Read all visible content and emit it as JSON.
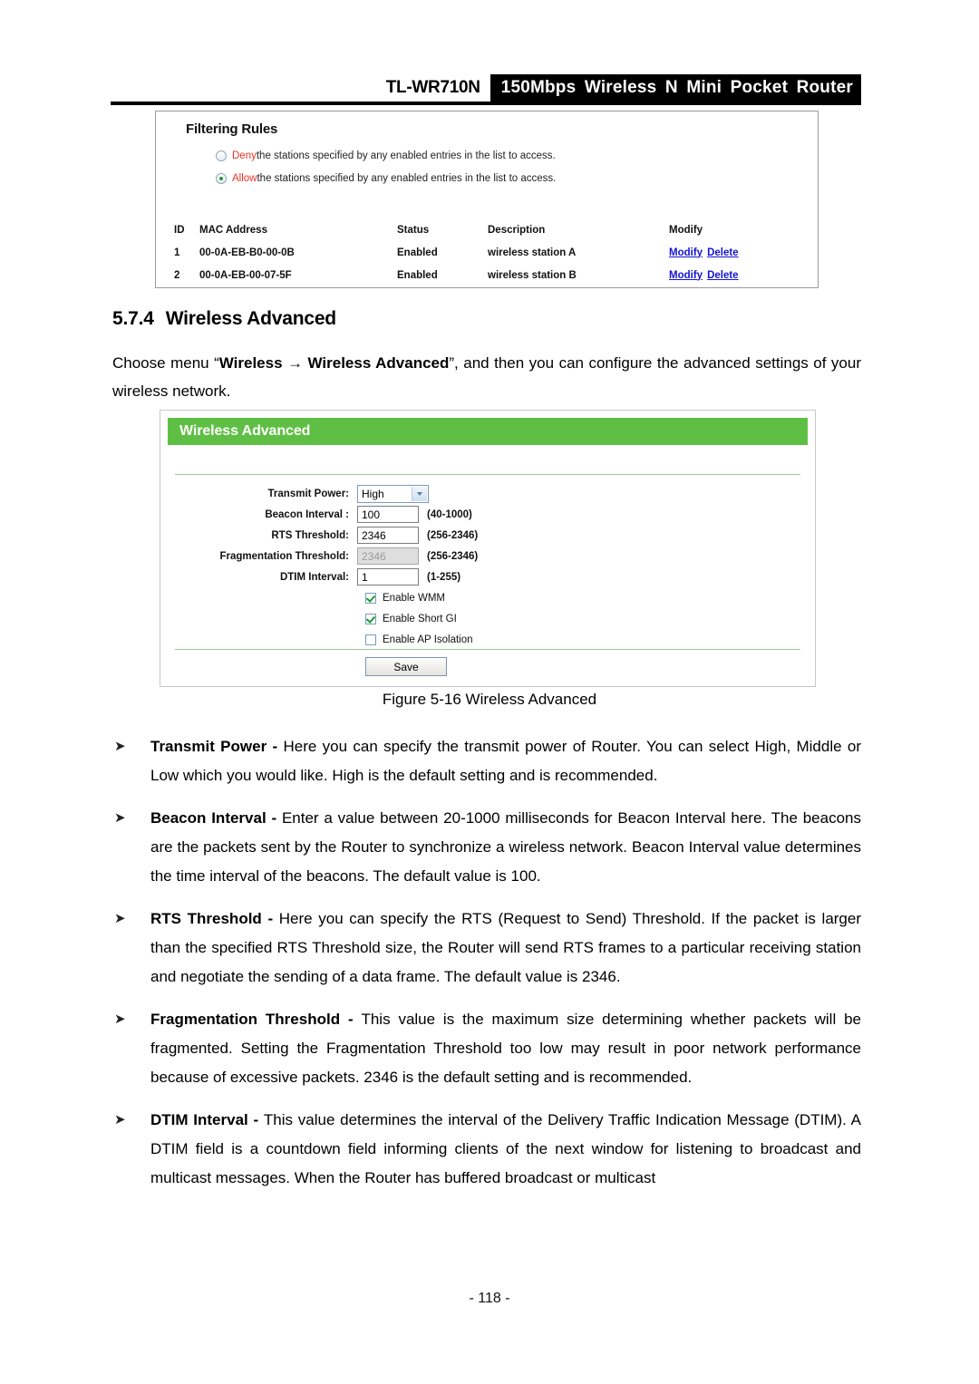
{
  "header": {
    "model": "TL-WR710N",
    "product": "150Mbps Wireless N Mini Pocket Router"
  },
  "filtering_screenshot": {
    "title": "Filtering Rules",
    "radios": [
      {
        "keyword": "Deny",
        "text": " the stations specified by any enabled entries in the list to access.",
        "selected": false
      },
      {
        "keyword": "Allow",
        "text": " the stations specified by any enabled entries in the list to access.",
        "selected": true
      }
    ],
    "table": {
      "columns": [
        "ID",
        "MAC Address",
        "Status",
        "Description",
        "Modify"
      ],
      "rows": [
        {
          "id": "1",
          "mac": "00-0A-EB-B0-00-0B",
          "status": "Enabled",
          "description": "wireless station A",
          "modify": "Modify",
          "delete": "Delete"
        },
        {
          "id": "2",
          "mac": "00-0A-EB-00-07-5F",
          "status": "Enabled",
          "description": "wireless station B",
          "modify": "Modify",
          "delete": "Delete"
        }
      ]
    },
    "link_color": "#1414cf",
    "keyword_color": "#ef3224"
  },
  "section": {
    "number": "5.7.4",
    "title": "Wireless Advanced"
  },
  "intro": {
    "prefix": "Choose menu “",
    "menu_1": "Wireless",
    "arrow": " → ",
    "menu_2": "Wireless Advanced",
    "suffix": "”, and then you can configure the advanced settings of your wireless network."
  },
  "advanced_screenshot": {
    "banner_title": "Wireless Advanced",
    "banner_color": "#5fbf44",
    "fields": [
      {
        "label": "Transmit Power:",
        "type": "select",
        "value": "High",
        "hint": ""
      },
      {
        "label": "Beacon Interval :",
        "type": "text",
        "value": "100",
        "hint": "(40-1000)"
      },
      {
        "label": "RTS Threshold:",
        "type": "text",
        "value": "2346",
        "hint": "(256-2346)"
      },
      {
        "label": "Fragmentation Threshold:",
        "type": "text-disabled",
        "value": "2346",
        "hint": "(256-2346)"
      },
      {
        "label": "DTIM Interval:",
        "type": "text",
        "value": "1",
        "hint": "(1-255)"
      }
    ],
    "checkboxes": [
      {
        "label": "Enable WMM",
        "checked": true
      },
      {
        "label": "Enable Short GI",
        "checked": true
      },
      {
        "label": "Enable AP Isolation",
        "checked": false
      }
    ],
    "save_label": "Save"
  },
  "figure_caption": "Figure 5-16 Wireless Advanced",
  "bullets": [
    {
      "marker": "➤",
      "term": "Transmit Power - ",
      "body": "Here you can specify the transmit power of Router. You can select High, Middle or Low which you would like. High is the default setting and is recommended."
    },
    {
      "marker": "➤",
      "term": "Beacon Interval - ",
      "body": "Enter a value between 20-1000 milliseconds for Beacon Interval here. The beacons are the packets sent by the Router to synchronize a wireless network. Beacon Interval value determines the time interval of the beacons. The default value is 100."
    },
    {
      "marker": "➤",
      "term": "RTS Threshold - ",
      "body": "Here you can specify the RTS (Request to Send) Threshold. If the packet is larger than the specified RTS Threshold size, the Router will send RTS frames to a particular receiving station and negotiate the sending of a data frame. The default value is 2346."
    },
    {
      "marker": "➤",
      "term": "Fragmentation Threshold - ",
      "body": "This value is the maximum size determining whether packets will be fragmented. Setting the Fragmentation Threshold too low may result in poor network performance because of excessive packets. 2346 is the default setting and is recommended."
    },
    {
      "marker": "➤",
      "term": "DTIM Interval - ",
      "body": "This value determines the interval of the Delivery Traffic Indication Message (DTIM). A DTIM field is a countdown field informing clients of the next window for listening to broadcast and multicast messages. When the Router has buffered broadcast or multicast"
    }
  ],
  "footer": {
    "page_number": "- 118 -"
  }
}
